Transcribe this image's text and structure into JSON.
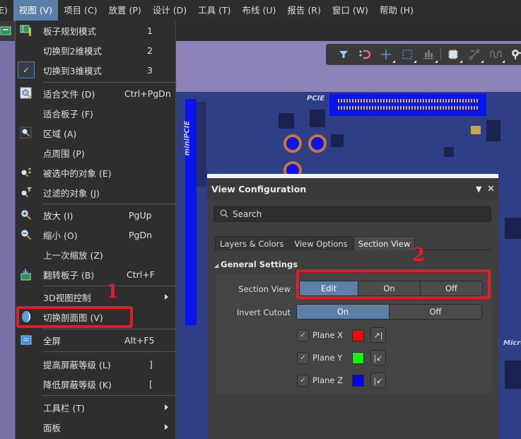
{
  "menubar": {
    "items": [
      {
        "label": "E)"
      },
      {
        "label": "视图 (V)",
        "active": true
      },
      {
        "label": "项目 (C)"
      },
      {
        "label": "放置 (P)"
      },
      {
        "label": "设计 (D)"
      },
      {
        "label": "工具 (T)"
      },
      {
        "label": "布线 (U)"
      },
      {
        "label": "报告 (R)"
      },
      {
        "label": "窗口 (W)"
      },
      {
        "label": "帮助 (H)"
      }
    ]
  },
  "view_menu": {
    "items": [
      {
        "label": "板子规划模式",
        "shortcut": "1",
        "icon": "board-planning-icon"
      },
      {
        "label": "切换到2维模式",
        "shortcut": "2"
      },
      {
        "label": "切换到3维模式",
        "shortcut": "3",
        "checked": true
      },
      {
        "label": "适合文件 (D)",
        "shortcut": "Ctrl+PgDn",
        "icon": "fit-document-icon"
      },
      {
        "label": "适合板子 (F)"
      },
      {
        "label": "区域 (A)",
        "icon": "zoom-area-icon"
      },
      {
        "label": "点周围 (P)"
      },
      {
        "label": "被选中的对象 (E)",
        "icon": "zoom-selected-icon"
      },
      {
        "label": "过滤的对象 (J)",
        "icon": "zoom-filtered-icon"
      },
      {
        "label": "放大 (I)",
        "shortcut": "PgUp",
        "icon": "zoom-in-icon"
      },
      {
        "label": "缩小 (O)",
        "shortcut": "PgDn",
        "icon": "zoom-out-icon"
      },
      {
        "label": "上一次缩放 (Z)"
      },
      {
        "label": "翻转板子 (B)",
        "shortcut": "Ctrl+F",
        "icon": "flip-board-icon"
      },
      {
        "label": "3D视图控制",
        "submenu": true
      },
      {
        "label": "切换剖面图 (V)",
        "icon": "section-view-icon",
        "highlighted": true
      },
      {
        "label": "全屏",
        "shortcut": "Alt+F5",
        "icon": "fullscreen-icon"
      },
      {
        "label": "提高屏蔽等级 (L)",
        "shortcut": "]"
      },
      {
        "label": "降低屏蔽等级 (K)",
        "shortcut": "["
      },
      {
        "label": "工具栏 (T)",
        "submenu": true
      },
      {
        "label": "面板",
        "submenu": true
      }
    ]
  },
  "annotations": {
    "step1": "1",
    "step2": "2",
    "color": "#e21b25"
  },
  "pcb": {
    "labels": {
      "pcie": "PCIE",
      "minipcie": "miniPCIE",
      "micro": "Micro"
    }
  },
  "active_toolbar": {
    "tools": [
      "filter-icon",
      "snap-magnet-icon",
      "cross-icon",
      "select-rect-icon",
      "align-icon",
      "component-icon",
      "route-icon",
      "wave-icon",
      "probe-icon"
    ]
  },
  "view_config": {
    "title": "View Configuration",
    "search_placeholder": "Search",
    "tabs": [
      {
        "label": "Layers & Colors"
      },
      {
        "label": "View Options"
      },
      {
        "label": "Section View",
        "active": true
      }
    ],
    "section_title": "General Settings",
    "section_view": {
      "label": "Section View",
      "options": [
        "Edit",
        "On",
        "Off"
      ],
      "selected": "Edit"
    },
    "invert_cutout": {
      "label": "Invert Cutout",
      "options": [
        "On",
        "Off"
      ],
      "selected": "On"
    },
    "planes": [
      {
        "label": "Plane X",
        "checked": true,
        "color": "#ff0000",
        "direction": "↗|"
      },
      {
        "label": "Plane Y",
        "checked": true,
        "color": "#00ff00",
        "direction": "|↙"
      },
      {
        "label": "Plane Z",
        "checked": true,
        "color": "#0000ff",
        "direction": "|↙"
      }
    ]
  }
}
